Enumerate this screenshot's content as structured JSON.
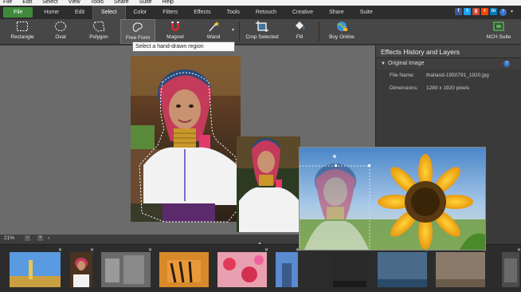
{
  "menu": {
    "items": [
      "File",
      "Edit",
      "Select",
      "View",
      "Tools",
      "Share",
      "Suite",
      "Help"
    ]
  },
  "tabs": {
    "items": [
      "File",
      "Home",
      "Edit",
      "Select",
      "Color",
      "Filters",
      "Effects",
      "Tools",
      "Retouch",
      "Creative",
      "Share",
      "Suite"
    ],
    "active": "Select"
  },
  "social": {
    "icons": [
      "facebook-icon",
      "twitter-icon",
      "google-icon",
      "reddit-icon",
      "linkedin-icon"
    ],
    "help_label": "?"
  },
  "toolbar": {
    "rectangle": "Rectangle",
    "oval": "Oval",
    "polygon": "Polygon",
    "free_form": "Free Form",
    "magnet": "Magnet",
    "wand": "Wand",
    "crop_selected": "Crop Selected",
    "fill": "Fill",
    "buy_online": "Buy Online",
    "nch_suite": "NCH Suite"
  },
  "tooltip": "Select a hand-drawn region",
  "panel": {
    "title": "Effects History and Layers",
    "original": "Original Image",
    "help": "?",
    "file_label": "File Name:",
    "file_value": "thailand-1950791_1920.jpg",
    "dim_label": "Dimensions:",
    "dim_value": "1280 x 1920 pixels"
  },
  "status": {
    "zoom": "21%",
    "minus": "−",
    "plus": "+",
    "arrow": "‹"
  },
  "colors": {
    "accent_green": "#3f8a3a",
    "panel": "#3a3a3a",
    "canvas": "#6b6b6b",
    "help_blue": "#3a71c9"
  }
}
